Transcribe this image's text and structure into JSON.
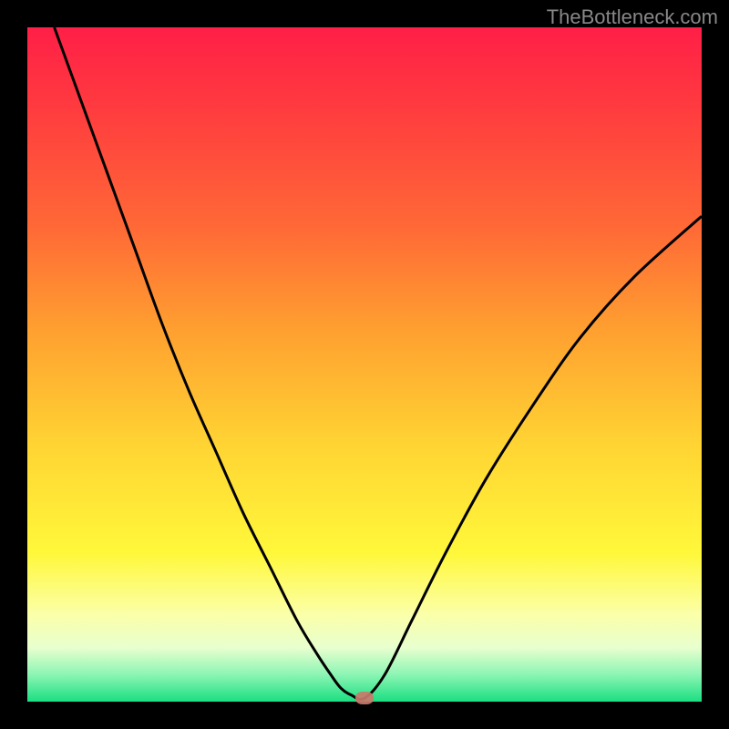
{
  "watermark": "TheBottleneck.com",
  "chart_data": {
    "type": "line",
    "title": "",
    "xlabel": "",
    "ylabel": "",
    "xlim": [
      0,
      100
    ],
    "ylim": [
      0,
      100
    ],
    "x": [
      4,
      8,
      12,
      16,
      20,
      24,
      28,
      32,
      36,
      40,
      43,
      45,
      46.5,
      48,
      50,
      53,
      57,
      62,
      68,
      75,
      82,
      90,
      100
    ],
    "values": [
      100,
      89,
      78,
      67,
      56,
      46,
      37,
      28,
      20,
      12,
      7,
      4,
      2,
      1,
      0.5,
      4,
      12,
      22,
      33,
      44,
      54,
      63,
      72
    ],
    "minimum_x": 50,
    "minimum_y": 0.5,
    "marker": {
      "x": 50,
      "y": 0.5
    },
    "gradient_stops": [
      {
        "pos": 0,
        "color": "#ff1f47"
      },
      {
        "pos": 100,
        "color": "#1adf81"
      }
    ]
  }
}
